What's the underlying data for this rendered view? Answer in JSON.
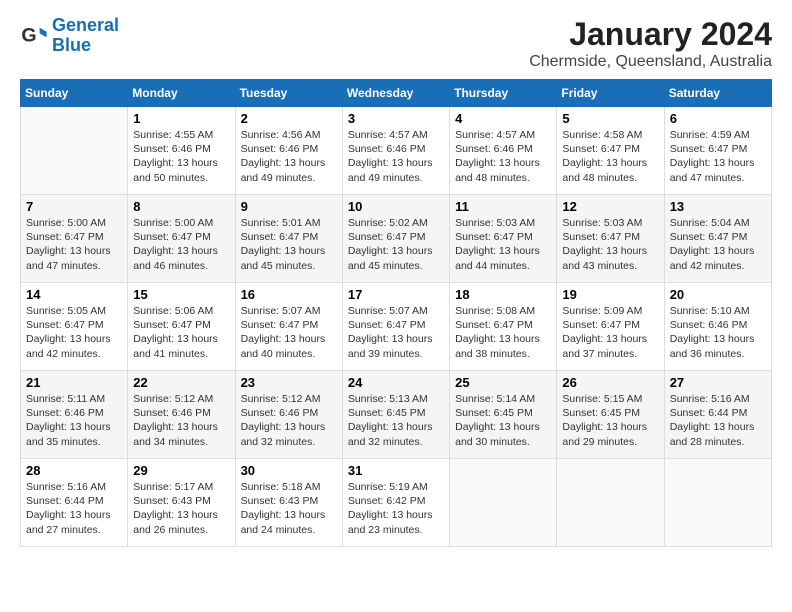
{
  "logo": {
    "line1": "General",
    "line2": "Blue"
  },
  "title": "January 2024",
  "subtitle": "Chermside, Queensland, Australia",
  "days_of_week": [
    "Sunday",
    "Monday",
    "Tuesday",
    "Wednesday",
    "Thursday",
    "Friday",
    "Saturday"
  ],
  "weeks": [
    [
      {
        "day": "",
        "content": ""
      },
      {
        "day": "1",
        "content": "Sunrise: 4:55 AM\nSunset: 6:46 PM\nDaylight: 13 hours\nand 50 minutes."
      },
      {
        "day": "2",
        "content": "Sunrise: 4:56 AM\nSunset: 6:46 PM\nDaylight: 13 hours\nand 49 minutes."
      },
      {
        "day": "3",
        "content": "Sunrise: 4:57 AM\nSunset: 6:46 PM\nDaylight: 13 hours\nand 49 minutes."
      },
      {
        "day": "4",
        "content": "Sunrise: 4:57 AM\nSunset: 6:46 PM\nDaylight: 13 hours\nand 48 minutes."
      },
      {
        "day": "5",
        "content": "Sunrise: 4:58 AM\nSunset: 6:47 PM\nDaylight: 13 hours\nand 48 minutes."
      },
      {
        "day": "6",
        "content": "Sunrise: 4:59 AM\nSunset: 6:47 PM\nDaylight: 13 hours\nand 47 minutes."
      }
    ],
    [
      {
        "day": "7",
        "content": "Sunrise: 5:00 AM\nSunset: 6:47 PM\nDaylight: 13 hours\nand 47 minutes."
      },
      {
        "day": "8",
        "content": "Sunrise: 5:00 AM\nSunset: 6:47 PM\nDaylight: 13 hours\nand 46 minutes."
      },
      {
        "day": "9",
        "content": "Sunrise: 5:01 AM\nSunset: 6:47 PM\nDaylight: 13 hours\nand 45 minutes."
      },
      {
        "day": "10",
        "content": "Sunrise: 5:02 AM\nSunset: 6:47 PM\nDaylight: 13 hours\nand 45 minutes."
      },
      {
        "day": "11",
        "content": "Sunrise: 5:03 AM\nSunset: 6:47 PM\nDaylight: 13 hours\nand 44 minutes."
      },
      {
        "day": "12",
        "content": "Sunrise: 5:03 AM\nSunset: 6:47 PM\nDaylight: 13 hours\nand 43 minutes."
      },
      {
        "day": "13",
        "content": "Sunrise: 5:04 AM\nSunset: 6:47 PM\nDaylight: 13 hours\nand 42 minutes."
      }
    ],
    [
      {
        "day": "14",
        "content": "Sunrise: 5:05 AM\nSunset: 6:47 PM\nDaylight: 13 hours\nand 42 minutes."
      },
      {
        "day": "15",
        "content": "Sunrise: 5:06 AM\nSunset: 6:47 PM\nDaylight: 13 hours\nand 41 minutes."
      },
      {
        "day": "16",
        "content": "Sunrise: 5:07 AM\nSunset: 6:47 PM\nDaylight: 13 hours\nand 40 minutes."
      },
      {
        "day": "17",
        "content": "Sunrise: 5:07 AM\nSunset: 6:47 PM\nDaylight: 13 hours\nand 39 minutes."
      },
      {
        "day": "18",
        "content": "Sunrise: 5:08 AM\nSunset: 6:47 PM\nDaylight: 13 hours\nand 38 minutes."
      },
      {
        "day": "19",
        "content": "Sunrise: 5:09 AM\nSunset: 6:47 PM\nDaylight: 13 hours\nand 37 minutes."
      },
      {
        "day": "20",
        "content": "Sunrise: 5:10 AM\nSunset: 6:46 PM\nDaylight: 13 hours\nand 36 minutes."
      }
    ],
    [
      {
        "day": "21",
        "content": "Sunrise: 5:11 AM\nSunset: 6:46 PM\nDaylight: 13 hours\nand 35 minutes."
      },
      {
        "day": "22",
        "content": "Sunrise: 5:12 AM\nSunset: 6:46 PM\nDaylight: 13 hours\nand 34 minutes."
      },
      {
        "day": "23",
        "content": "Sunrise: 5:12 AM\nSunset: 6:46 PM\nDaylight: 13 hours\nand 32 minutes."
      },
      {
        "day": "24",
        "content": "Sunrise: 5:13 AM\nSunset: 6:45 PM\nDaylight: 13 hours\nand 32 minutes."
      },
      {
        "day": "25",
        "content": "Sunrise: 5:14 AM\nSunset: 6:45 PM\nDaylight: 13 hours\nand 30 minutes."
      },
      {
        "day": "26",
        "content": "Sunrise: 5:15 AM\nSunset: 6:45 PM\nDaylight: 13 hours\nand 29 minutes."
      },
      {
        "day": "27",
        "content": "Sunrise: 5:16 AM\nSunset: 6:44 PM\nDaylight: 13 hours\nand 28 minutes."
      }
    ],
    [
      {
        "day": "28",
        "content": "Sunrise: 5:16 AM\nSunset: 6:44 PM\nDaylight: 13 hours\nand 27 minutes."
      },
      {
        "day": "29",
        "content": "Sunrise: 5:17 AM\nSunset: 6:43 PM\nDaylight: 13 hours\nand 26 minutes."
      },
      {
        "day": "30",
        "content": "Sunrise: 5:18 AM\nSunset: 6:43 PM\nDaylight: 13 hours\nand 24 minutes."
      },
      {
        "day": "31",
        "content": "Sunrise: 5:19 AM\nSunset: 6:42 PM\nDaylight: 13 hours\nand 23 minutes."
      },
      {
        "day": "",
        "content": ""
      },
      {
        "day": "",
        "content": ""
      },
      {
        "day": "",
        "content": ""
      }
    ]
  ]
}
